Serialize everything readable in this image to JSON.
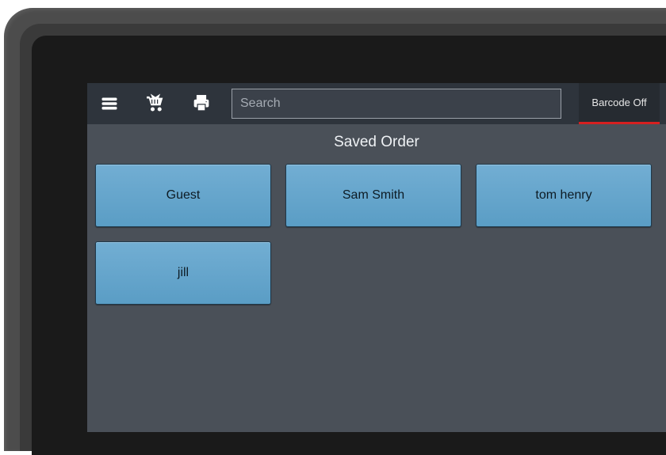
{
  "toolbar": {
    "menu_icon": "menu-icon",
    "cart_icon": "cart-icon",
    "print_icon": "print-icon",
    "search_placeholder": "Search",
    "barcode_label": "Barcode Off"
  },
  "content": {
    "title": "Saved Order",
    "orders": [
      {
        "label": "Guest"
      },
      {
        "label": "Sam Smith"
      },
      {
        "label": "tom henry"
      },
      {
        "label": "jill"
      }
    ]
  },
  "colors": {
    "tile_bg_top": "#72aed3",
    "tile_bg_bottom": "#5a9dc5",
    "barcode_underline": "#d62020"
  }
}
